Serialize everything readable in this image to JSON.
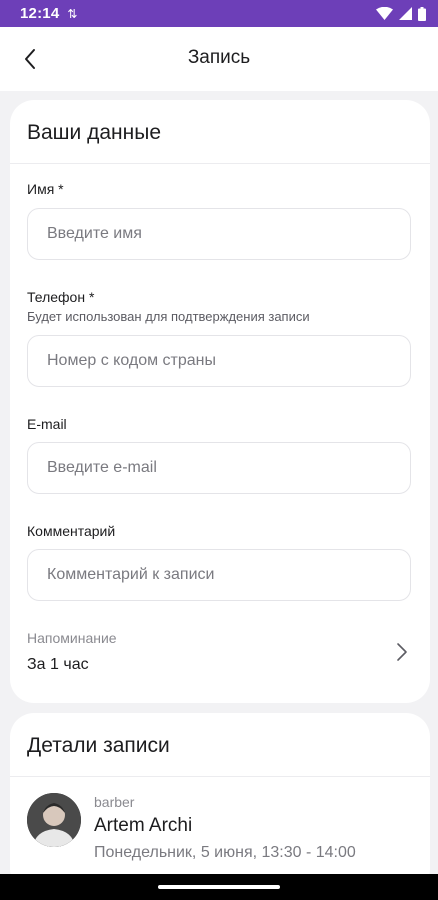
{
  "status_bar": {
    "time": "12:14",
    "sync_icon": "sync-icon",
    "wifi_icon": "wifi-icon",
    "signal_icon": "signal-icon",
    "battery_icon": "battery-icon"
  },
  "app_bar": {
    "title": "Запись",
    "back_icon": "back-arrow-icon"
  },
  "your_data": {
    "title": "Ваши данные",
    "name": {
      "label": "Имя *",
      "placeholder": "Введите имя",
      "value": ""
    },
    "phone": {
      "label": "Телефон *",
      "hint": "Будет использован для подтверждения записи",
      "placeholder": "Номер с кодом страны",
      "value": ""
    },
    "email": {
      "label": "E-mail",
      "placeholder": "Введите e-mail",
      "value": ""
    },
    "comment": {
      "label": "Комментарий",
      "placeholder": "Комментарий к записи",
      "value": ""
    },
    "reminder": {
      "label": "Напоминание",
      "value": "За 1 час",
      "icon": "chevron-right-icon"
    }
  },
  "booking_details": {
    "title": "Детали записи",
    "master": {
      "role": "barber",
      "name": "Artem Archi",
      "datetime": "Понедельник, 5 июня, 13:30 - 14:00"
    }
  },
  "colors": {
    "status_bar": "#6d3fb8",
    "background": "#f2f2f4",
    "card": "#ffffff",
    "input_border": "#e4e4e8",
    "placeholder": "#7a7a80",
    "nav_bar": "#000000"
  }
}
